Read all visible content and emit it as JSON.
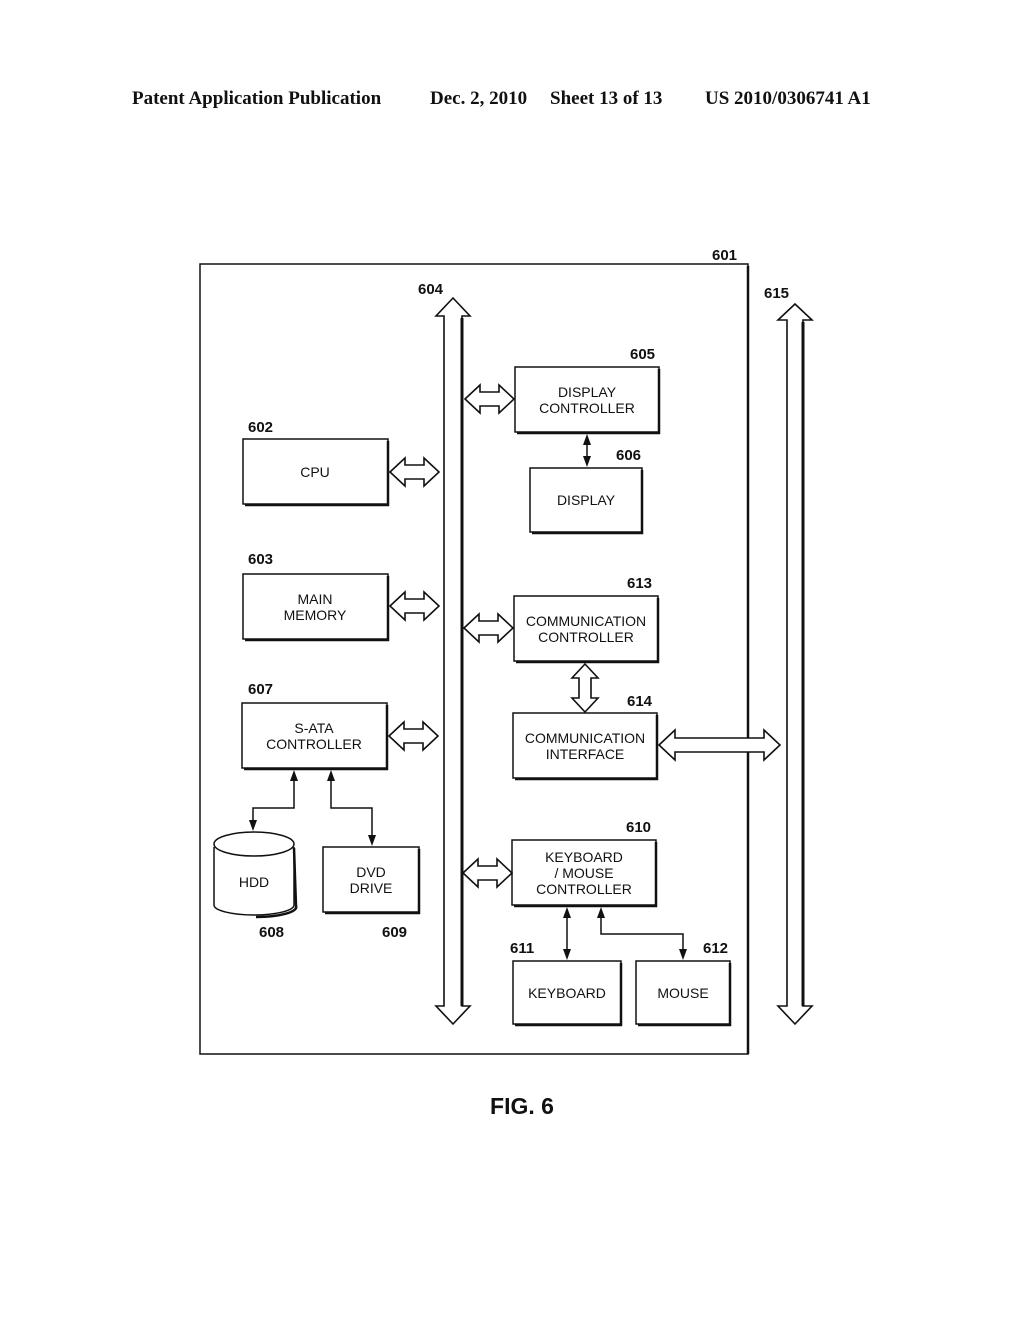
{
  "header": {
    "publication": "Patent Application Publication",
    "date": "Dec. 2, 2010",
    "sheet": "Sheet 13 of 13",
    "number": "US 2010/0306741 A1"
  },
  "figure": {
    "caption": "FIG. 6",
    "refs": {
      "computer": "601",
      "bus": "604",
      "network": "615"
    },
    "blocks": {
      "cpu": {
        "ref": "602",
        "lines": [
          "CPU"
        ]
      },
      "main_memory": {
        "ref": "603",
        "lines": [
          "MAIN",
          "MEMORY"
        ]
      },
      "sata_controller": {
        "ref": "607",
        "lines": [
          "S-ATA",
          "CONTROLLER"
        ]
      },
      "hdd": {
        "ref": "608",
        "lines": [
          "HDD"
        ]
      },
      "dvd_drive": {
        "ref": "609",
        "lines": [
          "DVD",
          "DRIVE"
        ]
      },
      "display_controller": {
        "ref": "605",
        "lines": [
          "DISPLAY",
          "CONTROLLER"
        ]
      },
      "display": {
        "ref": "606",
        "lines": [
          "DISPLAY"
        ]
      },
      "communication_controller": {
        "ref": "613",
        "lines": [
          "COMMUNICATION",
          "CONTROLLER"
        ]
      },
      "communication_interface": {
        "ref": "614",
        "lines": [
          "COMMUNICATION",
          "INTERFACE"
        ]
      },
      "keyboard_mouse_controller": {
        "ref": "610",
        "lines": [
          "KEYBOARD",
          "/ MOUSE",
          "CONTROLLER"
        ]
      },
      "keyboard": {
        "ref": "611",
        "lines": [
          "KEYBOARD"
        ]
      },
      "mouse": {
        "ref": "612",
        "lines": [
          "MOUSE"
        ]
      }
    }
  }
}
